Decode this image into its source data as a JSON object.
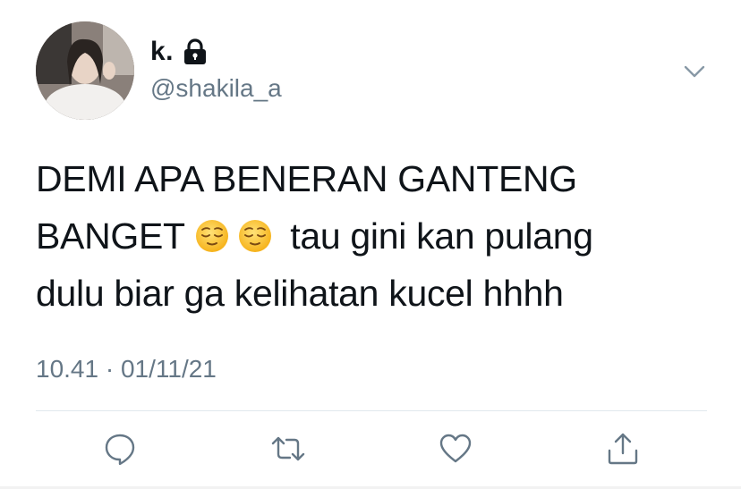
{
  "user": {
    "display_name": "k.",
    "handle": "@shakila_a",
    "protected_icon": "lock-icon",
    "avatar_icon": "profile-photo"
  },
  "tweet": {
    "line1": "DEMI APA BENERAN GANTENG",
    "line2_start": "BANGET",
    "emojis": [
      "relieved-face-emoji",
      "relieved-face-emoji"
    ],
    "line2_end": "tau gini kan pulang",
    "line3": "dulu biar ga kelihatan kucel hhhh",
    "timestamp": "10.41 · 01/11/21"
  },
  "actions": {
    "reply_icon": "comment-icon",
    "retweet_icon": "retweet-icon",
    "like_icon": "heart-icon",
    "share_icon": "share-icon"
  },
  "colors": {
    "text": "#0f1419",
    "secondary": "#657786",
    "divider": "#e1e8ed"
  }
}
